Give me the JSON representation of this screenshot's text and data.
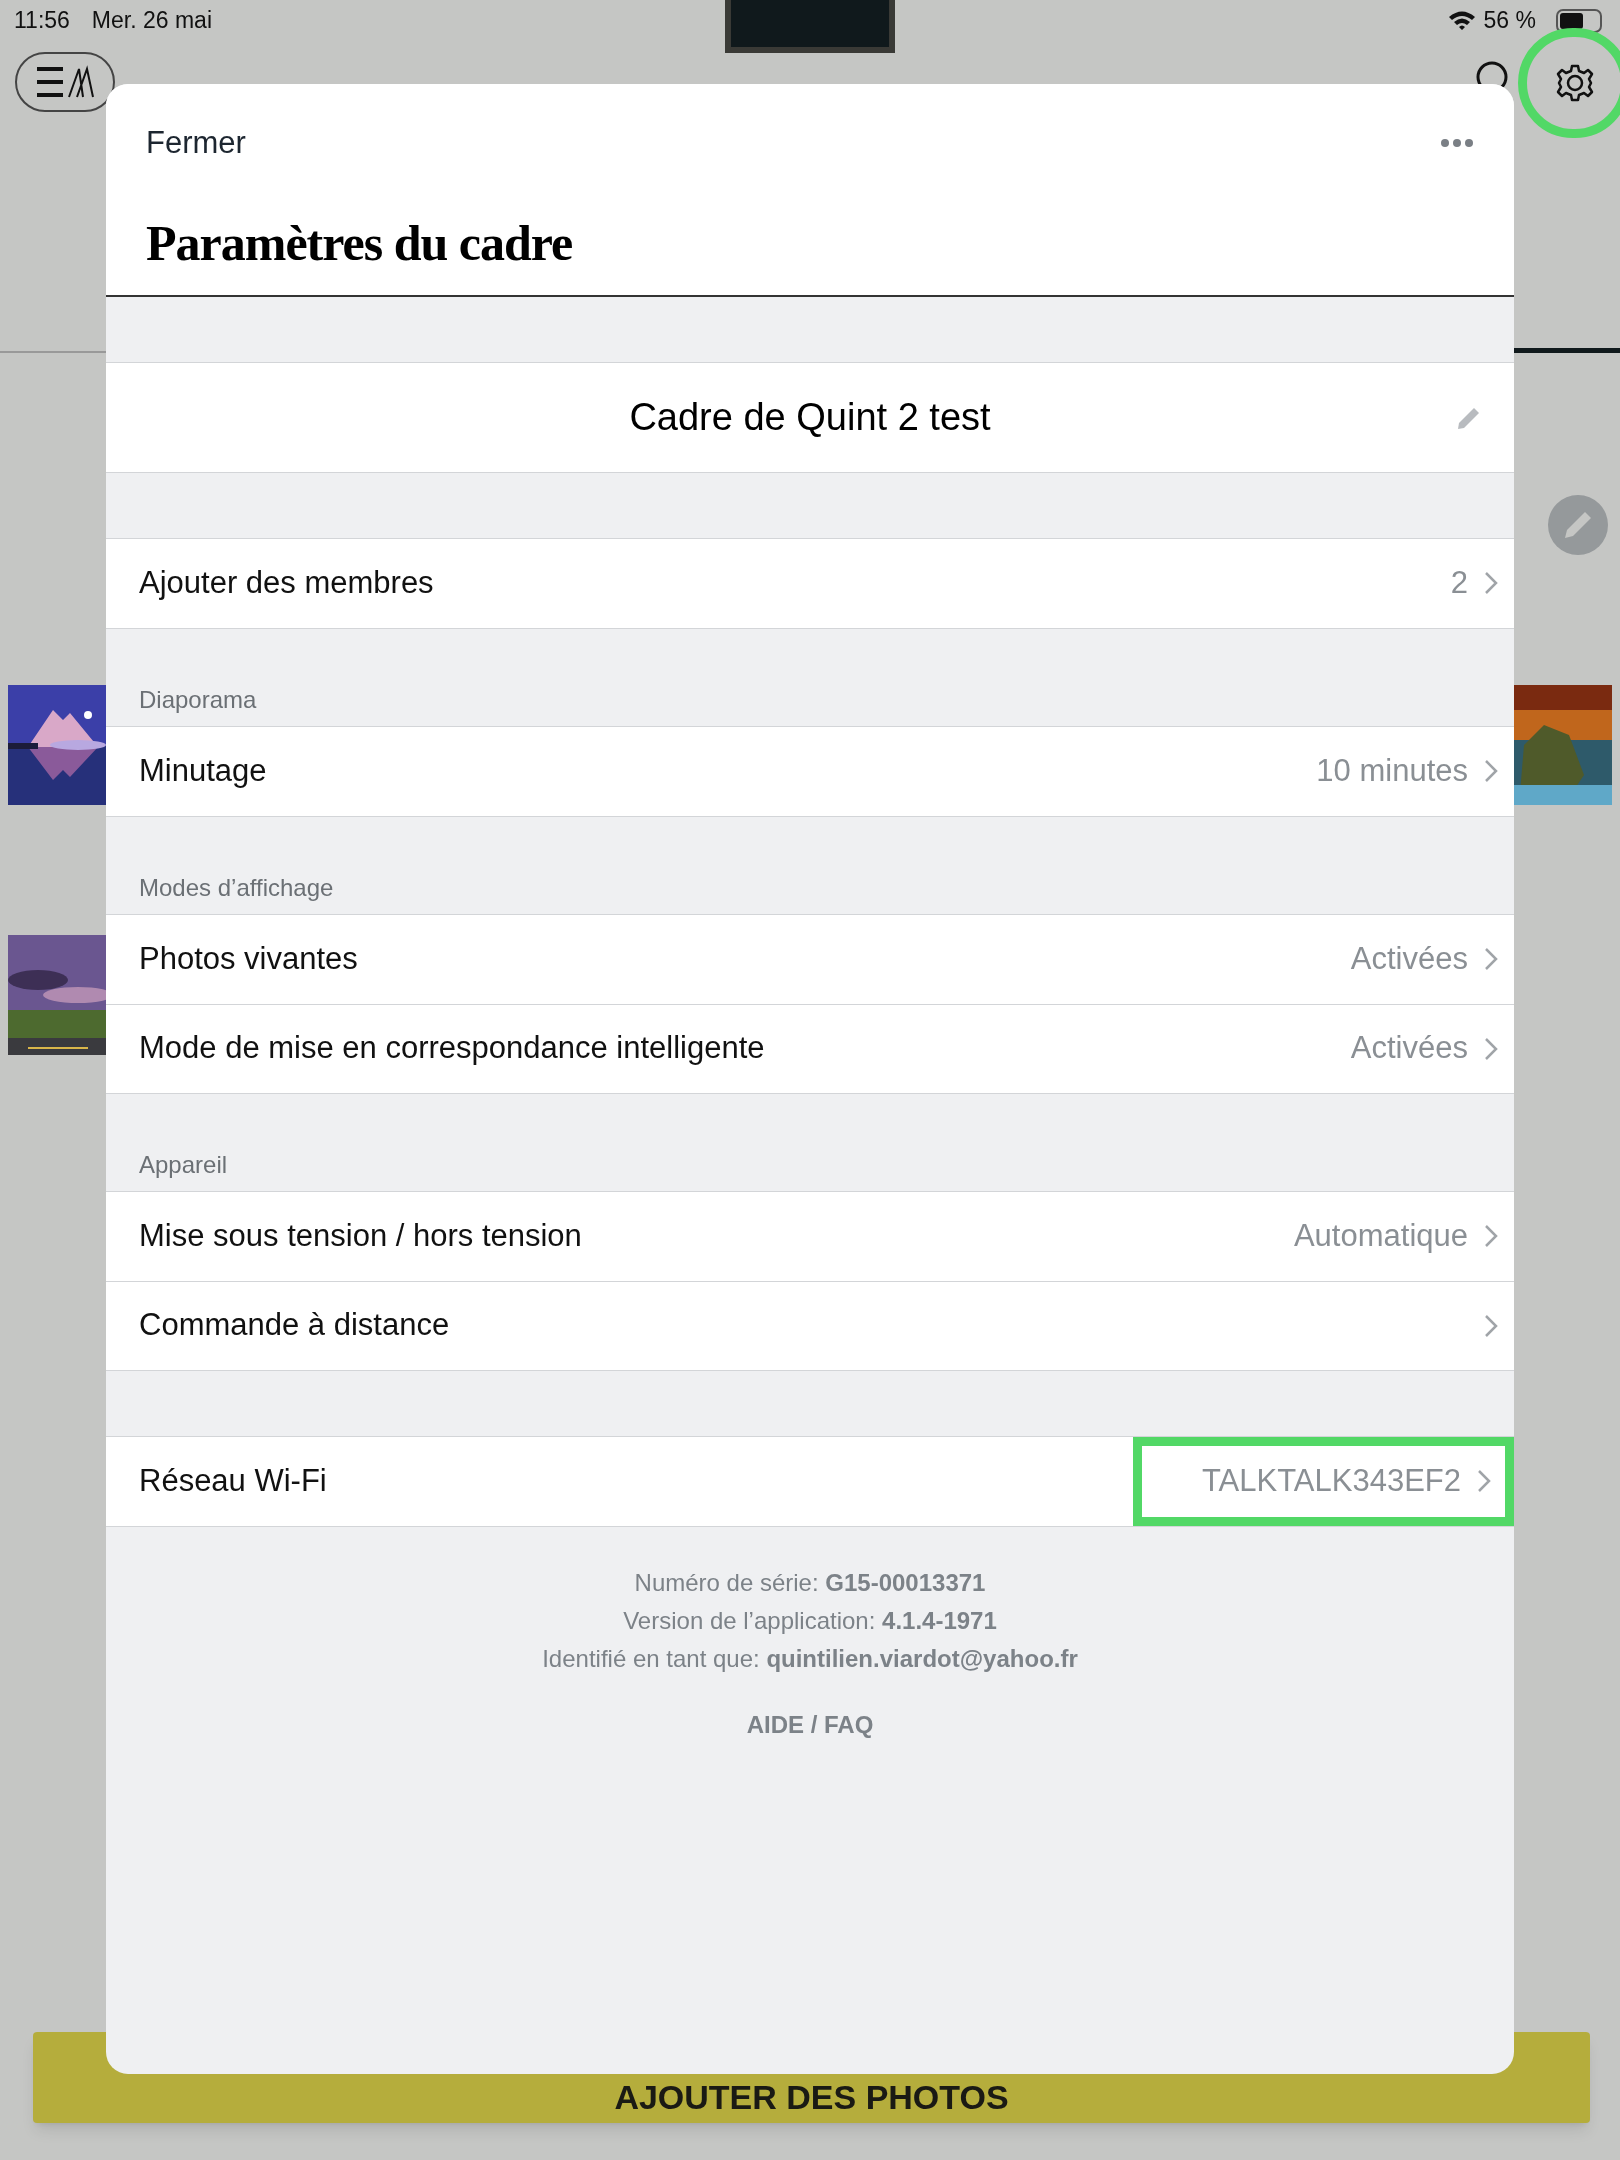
{
  "status_bar": {
    "time": "11:56",
    "date": "Mer. 26 mai",
    "battery": "56 %"
  },
  "top_bar": {
    "settings_highlighted": true
  },
  "background": {
    "button": "AJOUTER DES PHOTOS"
  },
  "modal": {
    "close": "Fermer",
    "title": "Paramètres du cadre",
    "frame_name": "Cadre de Quint 2 test",
    "groups": [
      {
        "rows": [
          {
            "label": "Ajouter des membres",
            "value": "2",
            "highlighted": false
          }
        ]
      },
      {
        "header": "Diaporama",
        "rows": [
          {
            "label": "Minutage",
            "value": "10 minutes",
            "highlighted": false
          }
        ]
      },
      {
        "header": "Modes d’affichage",
        "rows": [
          {
            "label": "Photos vivantes",
            "value": "Activées",
            "highlighted": false
          },
          {
            "label": "Mode de mise en correspondance intelligente",
            "value": "Activées",
            "highlighted": false
          }
        ]
      },
      {
        "header": "Appareil",
        "rows": [
          {
            "label": "Mise sous tension / hors tension",
            "value": "Automatique",
            "highlighted": false
          },
          {
            "label": "Commande à distance",
            "highlighted": false
          }
        ]
      },
      {
        "rows": [
          {
            "label": "Réseau Wi-Fi",
            "value": "TALKTALK343EF2",
            "highlighted": true
          }
        ]
      }
    ],
    "footer": [
      "Numéro de série: **G15-00013371**",
      "Version de l’application: **4.1.4-1971**",
      "Identifié en tant que: **quintilien.viardot@yahoo.fr**"
    ],
    "help_link": "AIDE / FAQ"
  }
}
